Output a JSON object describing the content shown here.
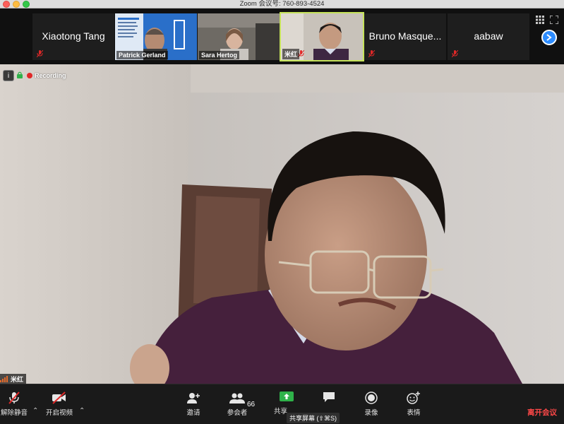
{
  "window": {
    "title": "Zoom 会议号: 760-893-4524"
  },
  "gallery": [
    {
      "name": "Xiaotong Tang",
      "type": "name",
      "muted": true
    },
    {
      "name": "Patrick Gerland",
      "type": "video",
      "muted": false
    },
    {
      "name": "Sara Hertog",
      "type": "video",
      "muted": false
    },
    {
      "name": "米红",
      "type": "video",
      "muted": true,
      "active": true
    },
    {
      "name": "Bruno Masque...",
      "type": "name",
      "muted": true
    },
    {
      "name": "aabaw",
      "type": "name",
      "muted": true
    }
  ],
  "status": {
    "recording_label": "Recording",
    "info_glyph": "i"
  },
  "main_video": {
    "speaker_name": "米红"
  },
  "toolbar": {
    "unmute_label": "解除静音",
    "start_video_label": "开启视频",
    "invite_label": "邀请",
    "participants_label": "参会者",
    "participants_count": "66",
    "share_label": "共享",
    "share_tooltip": "共享屏幕 (⇧⌘S)",
    "chat_label": "聊天",
    "record_label": "录像",
    "reactions_label": "表情",
    "leave_label": "离开会议"
  },
  "colors": {
    "accent": "#2d8cff",
    "active_border": "#c5e25a",
    "leave": "#ff4848",
    "recording": "#e02828"
  }
}
